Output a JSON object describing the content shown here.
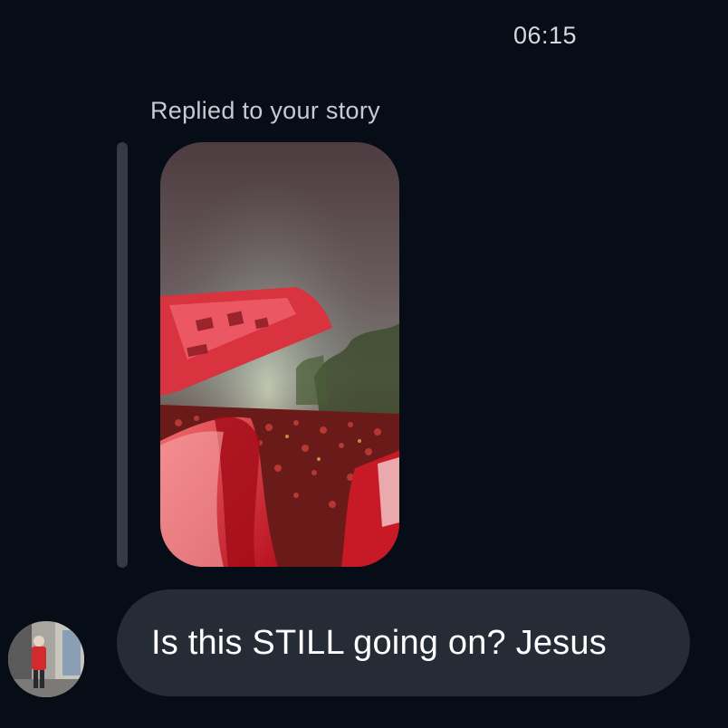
{
  "conversation": {
    "timestamp": "06:15",
    "reply_context_label": "Replied to your story",
    "story": {
      "media_type": "image",
      "subject": "night-crowd-with-red-flags"
    },
    "message": {
      "text": "Is this STILL going on? Jesus",
      "sender": "other"
    }
  },
  "colors": {
    "background": "#070d17",
    "bubble": "#262c35",
    "quote_bar": "#343b46",
    "timestamp_text": "#d6d9df",
    "label_text": "#c6cad2",
    "message_text": "#ffffff"
  }
}
